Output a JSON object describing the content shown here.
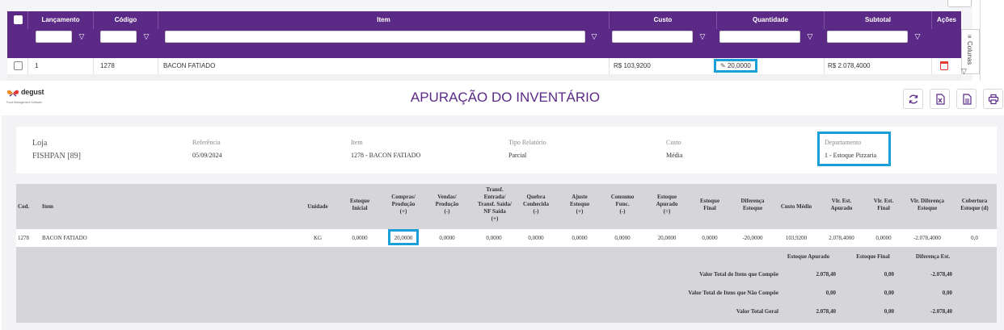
{
  "grid": {
    "headers": {
      "lancamento": "Lançamento",
      "codigo": "Código",
      "item": "Item",
      "custo": "Custo",
      "quantidade": "Quantidade",
      "subtotal": "Subtotal",
      "acoes": "Ações"
    },
    "columns_label": "Colunas",
    "row": {
      "lancamento": "1",
      "codigo": "1278",
      "item": "BACON FATIADO",
      "custo": "R$ 103,9200",
      "quantidade": "20,0000",
      "subtotal": "R$ 2.078,4000"
    }
  },
  "brand": {
    "name": "degust",
    "tagline": "Food Management Software"
  },
  "report": {
    "title": "APURAÇÃO DO INVENTÁRIO",
    "info": {
      "loja_label": "Loja",
      "loja": "FISHPAN [89]",
      "referencia_label": "Referência",
      "referencia": "05/09/2024",
      "item_label": "Item",
      "item": "1278 - BACON FATIADO",
      "tipo_label": "Tipo Relatório",
      "tipo": "Parcial",
      "custo_label": "Custo",
      "custo": "Média",
      "departamento_label": "Departamento",
      "departamento": "1 - Estoque Pizzaria"
    },
    "table": {
      "headers": {
        "cod": "Cod.",
        "item": "Item",
        "unidade": "Unidade",
        "estoque_inicial": [
          "Estoque",
          "Inicial"
        ],
        "compras": [
          "Compras/",
          "Produção",
          "(+)"
        ],
        "vendas": [
          "Vendas/",
          "Produção",
          "(-)"
        ],
        "transf": [
          "Transf.",
          "Entrada/",
          "Transf. Saída/",
          "NF Saída",
          "(+)"
        ],
        "quebra": [
          "Quebra",
          "Conhecida",
          "(-)"
        ],
        "ajuste": [
          "Ajuste",
          "Estoque",
          "(+)"
        ],
        "consumo": [
          "Consumo",
          "Func.",
          "(-)"
        ],
        "estoque_apurado": [
          "Estoque",
          "Apurado",
          "(=)"
        ],
        "estoque_final": [
          "Estoque",
          "Final"
        ],
        "diferenca_estoque": [
          "Diferença",
          "Estoque"
        ],
        "custo_medio": "Custo Médio",
        "vlr_est_apurado": [
          "Vlr. Est.",
          "Apurado"
        ],
        "vlr_est_final": [
          "Vlr. Est.",
          "Final"
        ],
        "vlr_diferenca": [
          "Vlr. Diferença",
          "Estoque"
        ],
        "cobertura": [
          "Cobertura",
          "Estoque (d)"
        ]
      },
      "row": {
        "cod": "1278",
        "item": "BACON FATIADO",
        "unidade": "KG",
        "estoque_inicial": "0,0000",
        "compras": "20,0000",
        "vendas": "0,0000",
        "transf": "0,0000",
        "quebra": "0,0000",
        "ajuste": "0,0000",
        "consumo": "0,0000",
        "estoque_apurado": "20,0000",
        "estoque_final": "0,0000",
        "diferenca_estoque": "-20,0000",
        "custo_medio": "103,9200",
        "vlr_est_apurado": "2.078,4000",
        "vlr_est_final": "0,0000",
        "vlr_diferenca": "-2.078,4000",
        "cobertura": "0,0"
      },
      "totals": {
        "col_apurado": "Estoque Apurado",
        "col_final": "Estoque Final",
        "col_diferenca": "Diferença Est.",
        "rows": [
          {
            "label": "Valor Total de Itens que Compõe",
            "apurado": "2.078,40",
            "final": "0,00",
            "diferenca": "-2.078,40"
          },
          {
            "label": "Valor Total de Itens que Não Compõe",
            "apurado": "0,00",
            "final": "0,00",
            "diferenca": "0,00"
          },
          {
            "label": "Valor Total Geral",
            "apurado": "2.078,40",
            "final": "0,00",
            "diferenca": "-2.078,40"
          }
        ]
      }
    }
  }
}
